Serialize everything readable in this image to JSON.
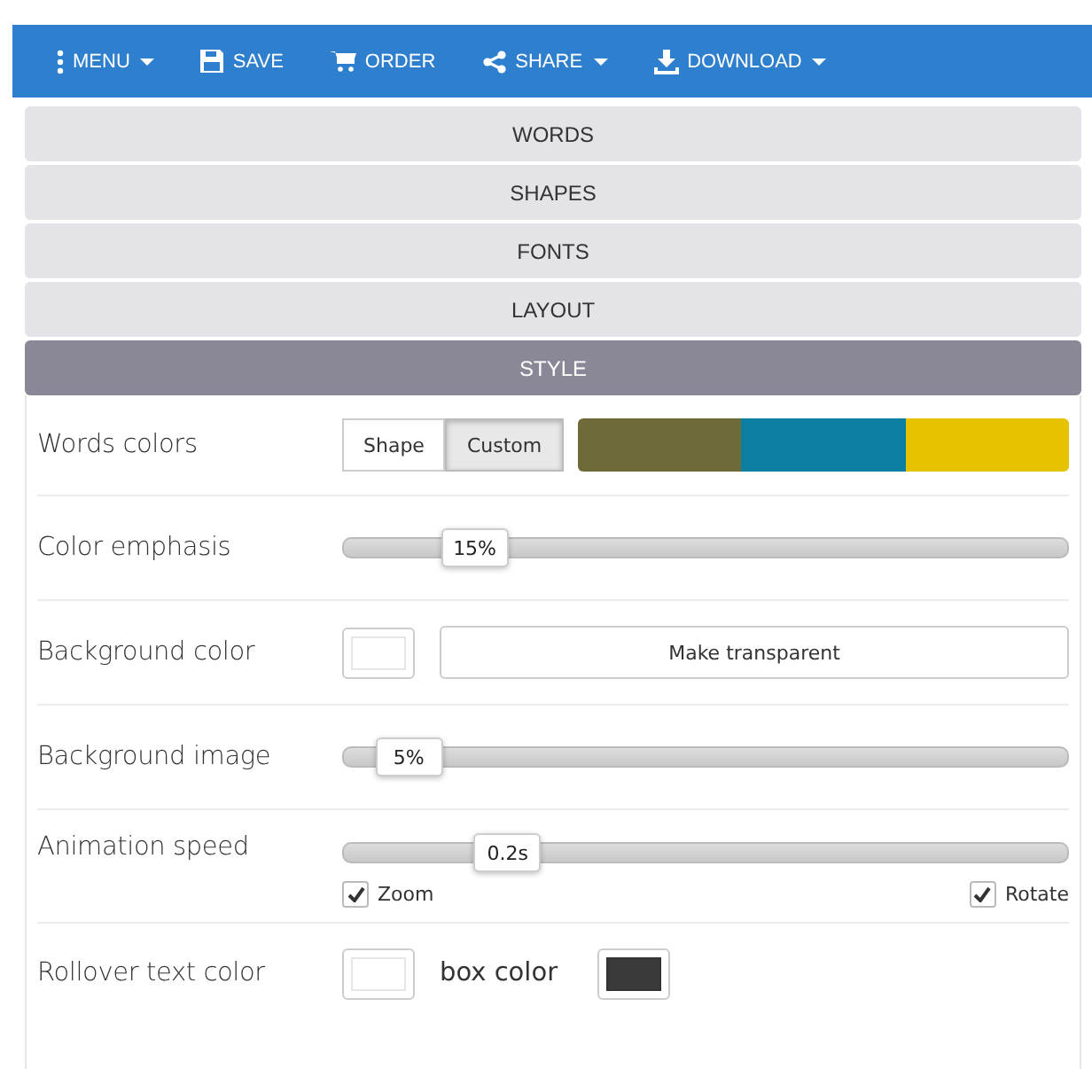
{
  "toolbar": [
    {
      "kind": "menu",
      "label": "MENU",
      "dropdown": true
    },
    {
      "kind": "save",
      "label": "SAVE",
      "dropdown": false
    },
    {
      "kind": "order",
      "label": "ORDER",
      "dropdown": false
    },
    {
      "kind": "share",
      "label": "SHARE",
      "dropdown": true
    },
    {
      "kind": "download",
      "label": "DOWNLOAD",
      "dropdown": true
    }
  ],
  "sections": [
    {
      "label": "WORDS",
      "selected": false
    },
    {
      "label": "SHAPES",
      "selected": false
    },
    {
      "label": "FONTS",
      "selected": false
    },
    {
      "label": "LAYOUT",
      "selected": false
    },
    {
      "label": "STYLE",
      "selected": true
    }
  ],
  "style_rows": [
    {
      "kind": "colors",
      "label": "Words colors",
      "options": [
        {
          "label": "Shape",
          "selected": false
        },
        {
          "label": "Custom",
          "selected": true
        }
      ],
      "swatches": [
        {
          "color": "#6f6a3a"
        },
        {
          "color": "#0d7fa3"
        },
        {
          "color": "#e6c200"
        }
      ]
    },
    {
      "kind": "slider",
      "label": "Color emphasis",
      "level": 0.15,
      "reading": "15%"
    },
    {
      "kind": "background",
      "label": "Background color",
      "button": "Make transparent"
    },
    {
      "kind": "slider",
      "label": "Background image",
      "level": 0.05,
      "reading": "5%"
    },
    {
      "kind": "slider",
      "label": "Animation speed",
      "level": 0.2,
      "reading": "0.2s",
      "checkboxes": [
        {
          "label": "Zoom",
          "checked": true
        },
        {
          "label": "Rotate",
          "checked": true
        }
      ]
    },
    {
      "kind": "rollover",
      "label": "Rollover text color",
      "second_label": "box color"
    }
  ]
}
